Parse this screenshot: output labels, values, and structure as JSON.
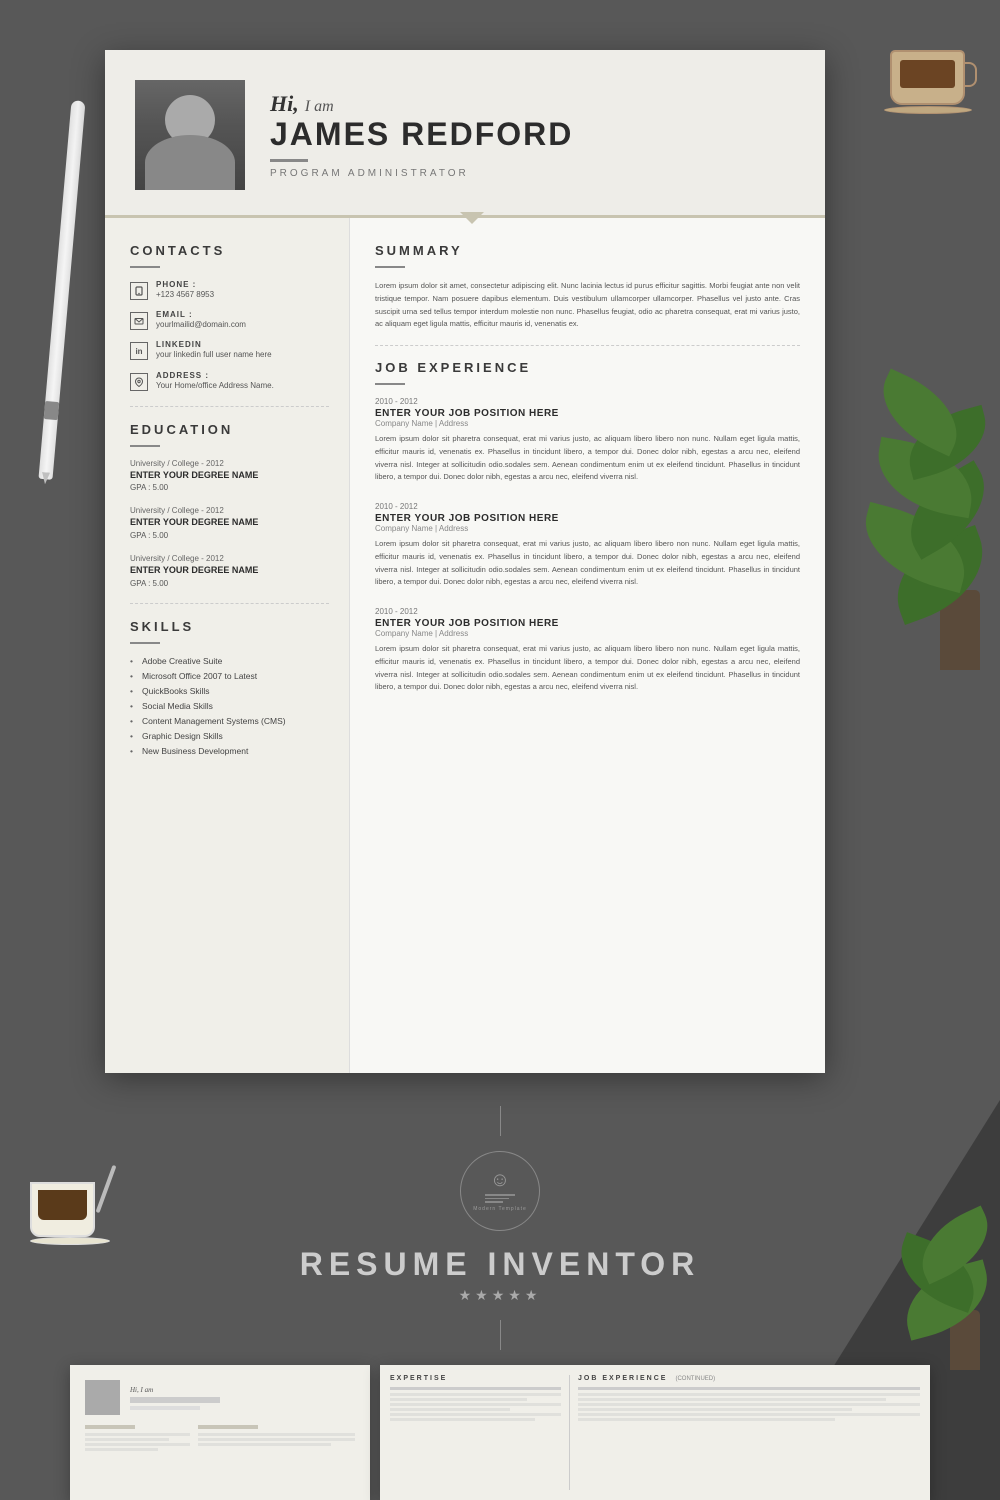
{
  "background": {
    "color": "#555555"
  },
  "header": {
    "greeting": "Hi,",
    "greeting_suffix": "I am",
    "name": "JAMES REDFORD",
    "divider": "—",
    "title": "PROGRAM ADMINISTRATOR"
  },
  "contacts": {
    "section_title": "CONTACTS",
    "phone_label": "PHONE :",
    "phone_value": "+123 4567 8953",
    "email_label": "EMAIL :",
    "email_value": "yourlmailid@domain.com",
    "linkedin_label": "LINKEDIN",
    "linkedin_value": "your linkedin full user name here",
    "address_label": "ADDRESS :",
    "address_value": "Your Home/office Address Name."
  },
  "education": {
    "section_title": "EDUCATION",
    "items": [
      {
        "institution": "University / College - 2012",
        "degree": "ENTER YOUR DEGREE NAME",
        "gpa": "GPA : 5.00"
      },
      {
        "institution": "University / College - 2012",
        "degree": "ENTER YOUR DEGREE NAME",
        "gpa": "GPA : 5.00"
      },
      {
        "institution": "University / College - 2012",
        "degree": "ENTER YOUR DEGREE NAME",
        "gpa": "GPA : 5.00"
      }
    ]
  },
  "skills": {
    "section_title": "SKILLS",
    "items": [
      "Adobe Creative Suite",
      "Microsoft Office 2007 to Latest",
      "QuickBooks Skills",
      "Social Media Skills",
      "Content Management Systems (CMS)",
      "Graphic Design Skills",
      "New Business Development"
    ]
  },
  "summary": {
    "section_title": "SUMMARY",
    "text": "Lorem ipsum dolor sit amet, consectetur adipiscing elit. Nunc lacinia lectus id purus efficitur sagittis. Morbi feugiat ante non velit tristique tempor. Nam posuere dapibus elementum. Duis vestibulum ullamcorper ullamcorper. Phasellus vel justo ante. Cras suscipit urna sed tellus tempor interdum molestie non nunc. Phasellus feugiat, odio ac pharetra consequat, erat mi varius justo, ac aliquam eget ligula mattis, efficitur mauris id, venenatis ex."
  },
  "job_experience": {
    "section_title": "JOB EXPERIENCE",
    "items": [
      {
        "years": "2010 - 2012",
        "title": "ENTER YOUR JOB POSITION HERE",
        "company": "Company Name | Address",
        "description": "Lorem ipsum dolor sit pharetra consequat, erat mi varius justo, ac aliquam libero libero non nunc. Nullam eget ligula mattis, efficitur mauris id, venenatis ex. Phasellus in tincidunt libero, a tempor dui. Donec dolor nibh, egestas a arcu nec, eleifend viverra nisl. Integer at sollicitudin odio.sodales sem. Aenean condimentum enim ut ex eleifend tincidunt. Phasellus in tincidunt libero, a tempor dui. Donec dolor nibh, egestas a arcu nec, eleifend viverra nisl."
      },
      {
        "years": "2010 - 2012",
        "title": "ENTER YOUR JOB POSITION HERE",
        "company": "Company Name | Address",
        "description": "Lorem ipsum dolor sit pharetra consequat, erat mi varius justo, ac aliquam libero libero non nunc. Nullam eget ligula mattis, efficitur mauris id, venenatis ex. Phasellus in tincidunt libero, a tempor dui. Donec dolor nibh, egestas a arcu nec, eleifend viverra nisl. Integer at sollicitudin odio.sodales sem. Aenean condimentum enim ut ex eleifend tincidunt. Phasellus in tincidunt libero, a tempor dui. Donec dolor nibh, egestas a arcu nec, eleifend viverra nisl."
      },
      {
        "years": "2010 - 2012",
        "title": "ENTER YOUR JOB POSITION HERE",
        "company": "Company Name | Address",
        "description": "Lorem ipsum dolor sit pharetra consequat, erat mi varius justo, ac aliquam libero libero non nunc. Nullam eget ligula mattis, efficitur mauris id, venenatis ex. Phasellus in tincidunt libero, a tempor dui. Donec dolor nibh, egestas a arcu nec, eleifend viverra nisl. Integer at sollicitudin odio.sodales sem. Aenean condimentum enim ut ex eleifend tincidunt. Phasellus in tincidunt libero, a tempor dui. Donec dolor nibh, egestas a arcu nec, eleifend viverra nisl."
      }
    ]
  },
  "branding": {
    "name": "RESUME INVENTOR",
    "stars": "★★★★★"
  },
  "preview": {
    "left_header": "Hi, I am",
    "expertise_label": "EXPERTISE",
    "job_exp_label": "JOB EXPERIENCE",
    "continued_label": "(CONTINUED)"
  }
}
